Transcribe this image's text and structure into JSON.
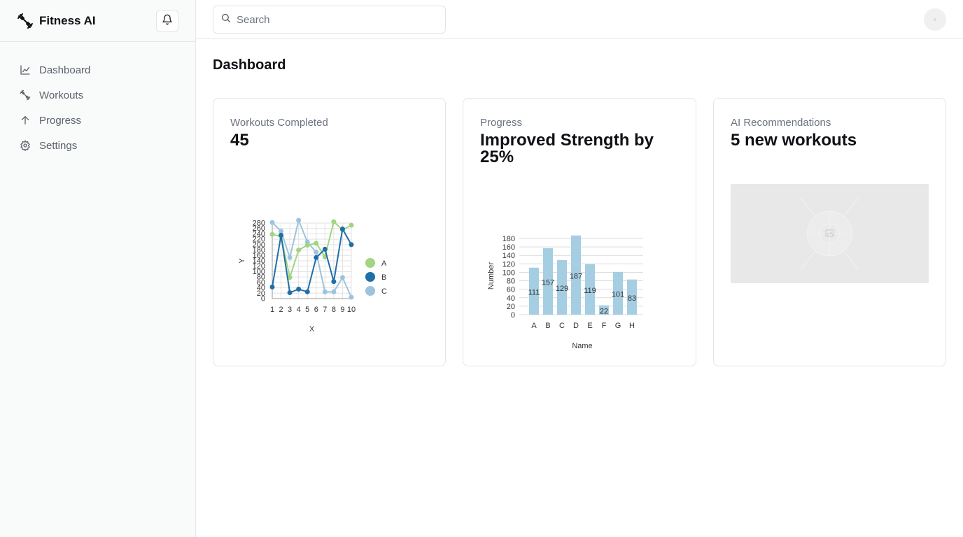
{
  "app": {
    "name": "Fitness AI"
  },
  "sidebar": {
    "items": [
      {
        "label": "Dashboard",
        "icon": "line-chart-icon"
      },
      {
        "label": "Workouts",
        "icon": "dumbbell-icon"
      },
      {
        "label": "Progress",
        "icon": "arrow-up-icon"
      },
      {
        "label": "Settings",
        "icon": "gear-icon"
      }
    ]
  },
  "search": {
    "placeholder": "Search",
    "value": ""
  },
  "main": {
    "title": "Dashboard",
    "cards": [
      {
        "label": "Workouts Completed",
        "value": "45"
      },
      {
        "label": "Progress",
        "value": "Improved Strength by 25%"
      },
      {
        "label": "AI Recommendations",
        "value": "5 new workouts"
      }
    ]
  },
  "colors": {
    "series_a": "#a1d57f",
    "series_b": "#1f6ea8",
    "series_c": "#9cc4dc",
    "bar": "#a6cee3"
  },
  "chart_data": [
    {
      "type": "line",
      "title": "",
      "xlabel": "X",
      "ylabel": "Y",
      "x": [
        1,
        2,
        3,
        4,
        5,
        6,
        7,
        8,
        9,
        10
      ],
      "xlim": [
        1,
        10
      ],
      "ylim": [
        0,
        280
      ],
      "yticks": [
        0,
        20,
        40,
        60,
        80,
        100,
        120,
        140,
        160,
        180,
        200,
        220,
        240,
        260,
        280
      ],
      "grid": true,
      "legend": "right",
      "series": [
        {
          "name": "A",
          "values": [
            238,
            230,
            78,
            180,
            198,
            205,
            155,
            285,
            255,
            272
          ]
        },
        {
          "name": "B",
          "values": [
            43,
            235,
            22,
            35,
            25,
            152,
            183,
            63,
            258,
            200
          ]
        },
        {
          "name": "C",
          "values": [
            282,
            250,
            152,
            290,
            210,
            172,
            25,
            25,
            78,
            5
          ]
        }
      ]
    },
    {
      "type": "bar",
      "title": "",
      "xlabel": "Name",
      "ylabel": "Number",
      "categories": [
        "A",
        "B",
        "C",
        "D",
        "E",
        "F",
        "G",
        "H"
      ],
      "values": [
        111,
        157,
        129,
        187,
        119,
        22,
        101,
        83
      ],
      "ylim": [
        0,
        180
      ],
      "yticks": [
        0,
        20,
        40,
        60,
        80,
        100,
        120,
        140,
        160,
        180
      ],
      "grid": true
    }
  ]
}
